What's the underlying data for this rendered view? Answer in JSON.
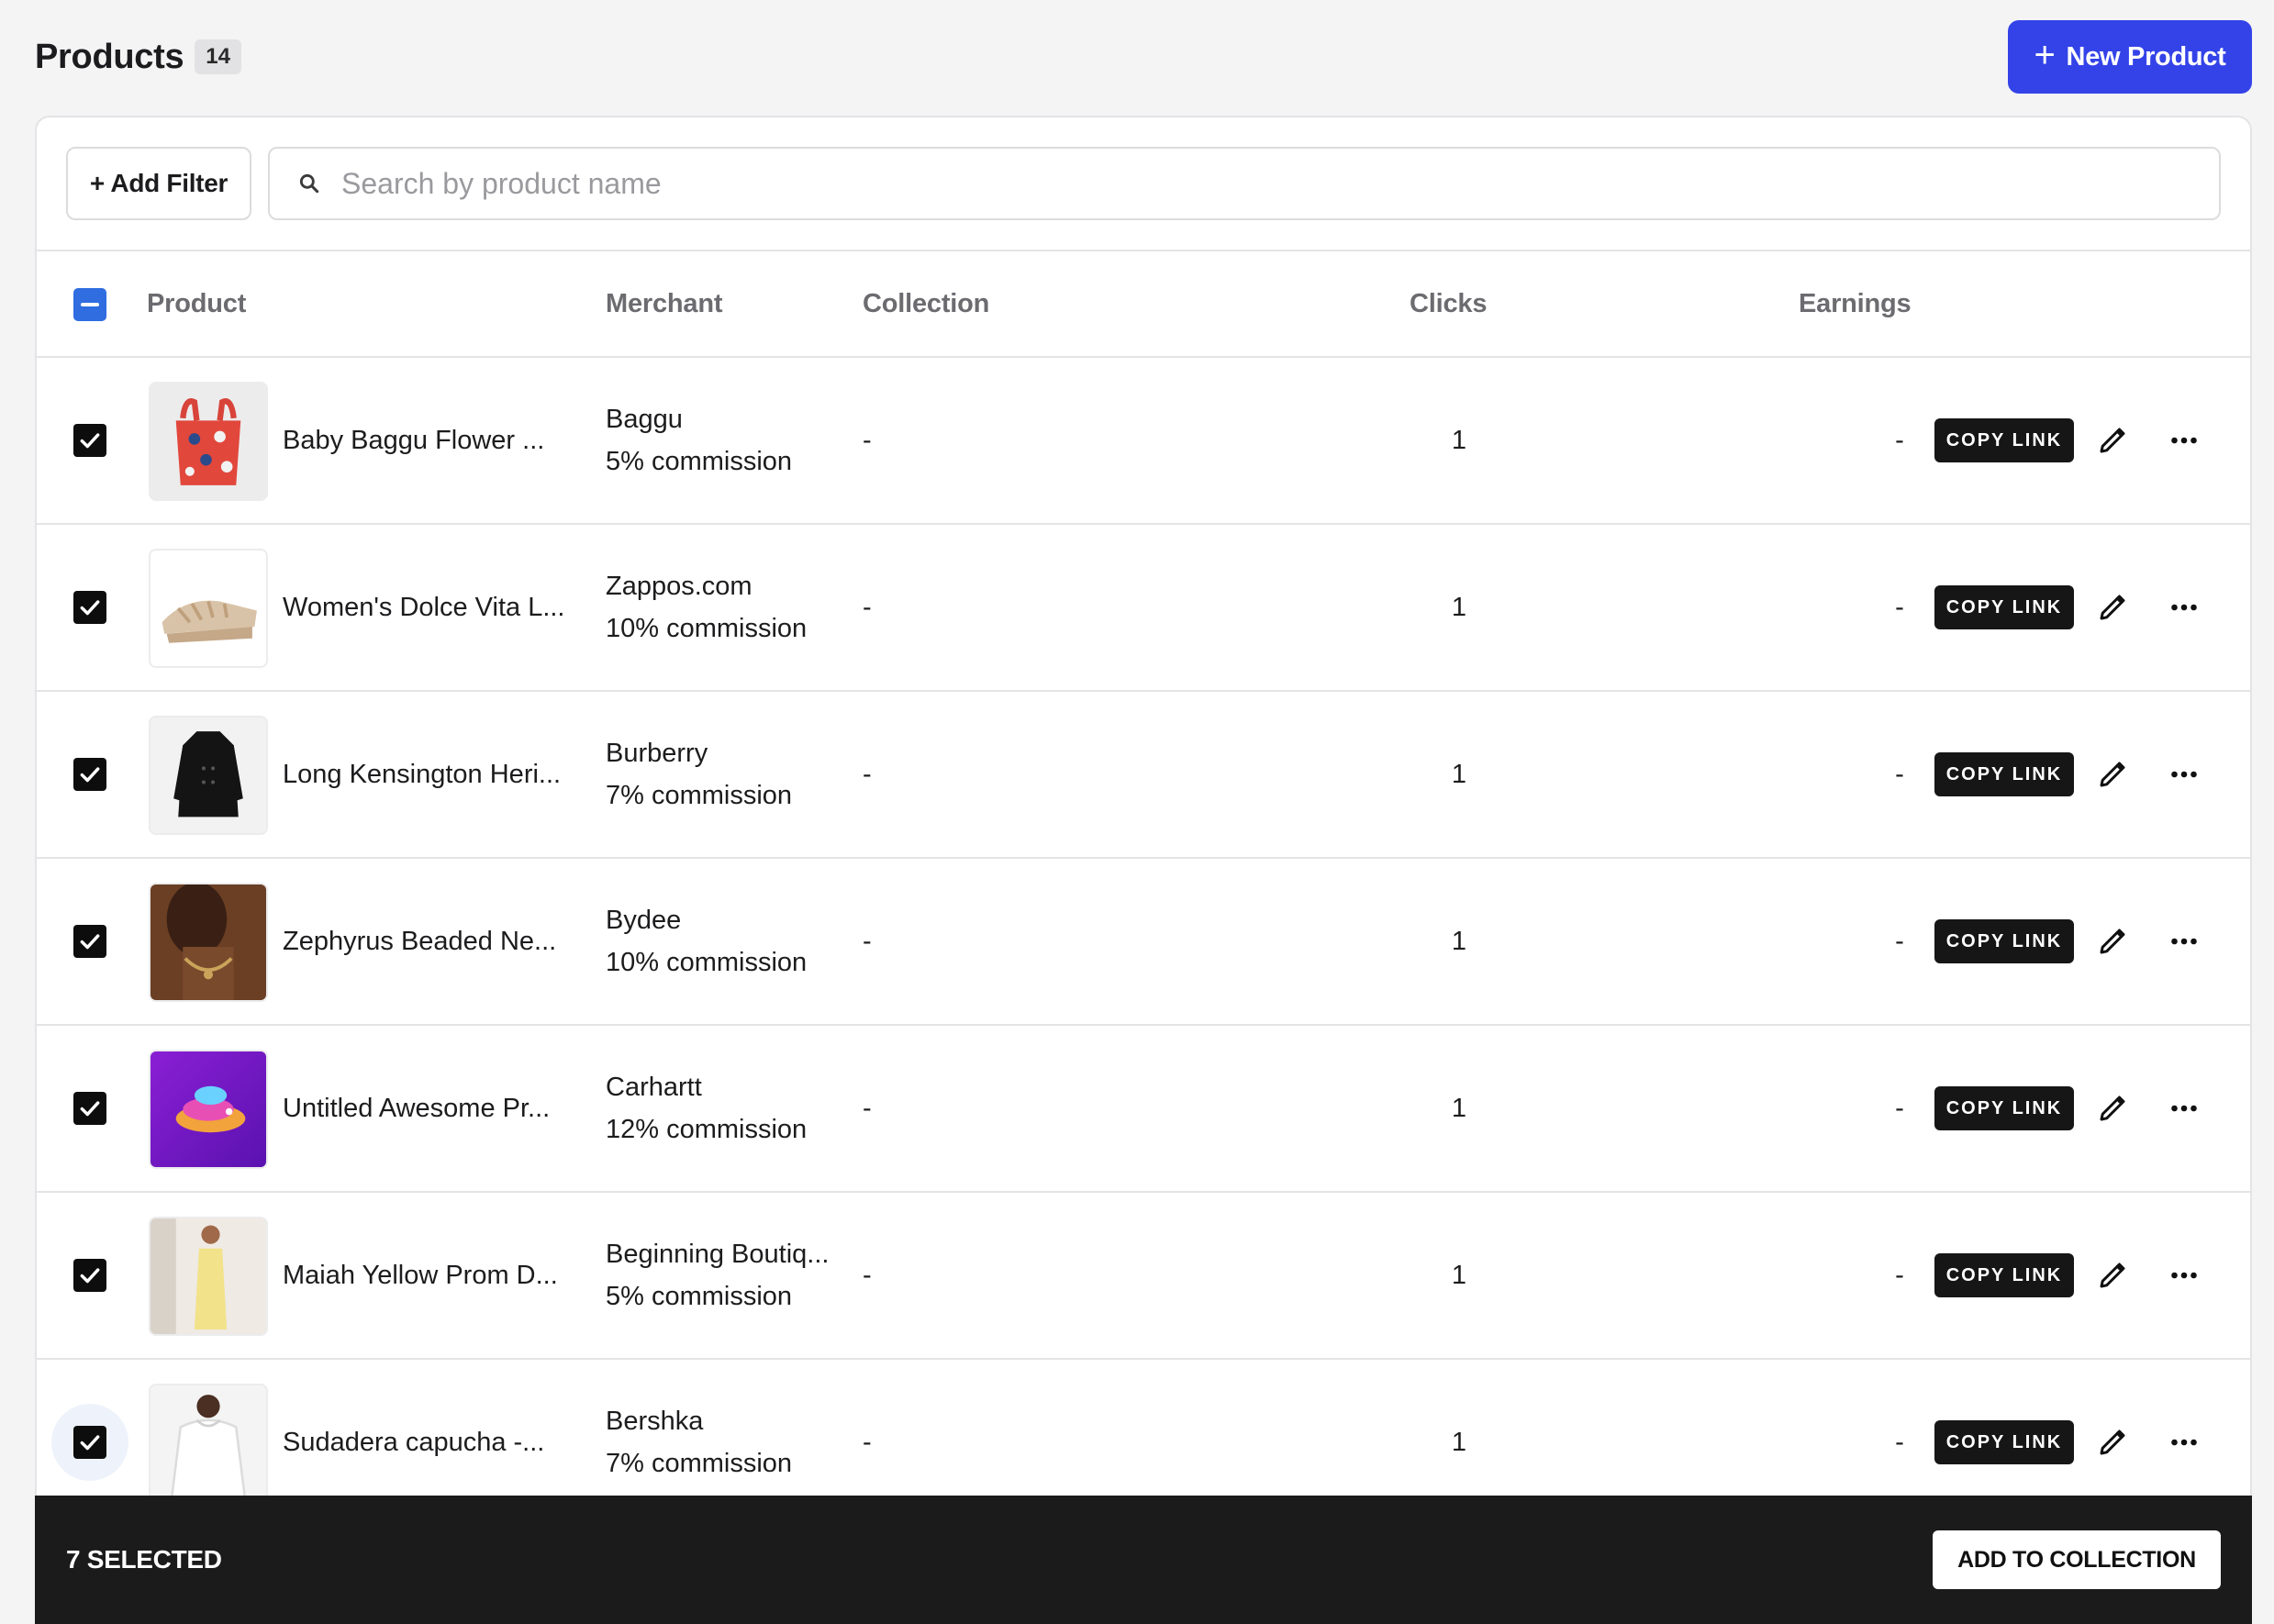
{
  "header": {
    "title": "Products",
    "count": "14",
    "new_product_label": "New Product"
  },
  "toolbar": {
    "add_filter_label": "+ Add Filter",
    "search_placeholder": "Search by product name",
    "search_value": ""
  },
  "table": {
    "columns": [
      "Product",
      "Merchant",
      "Collection",
      "Clicks",
      "Earnings"
    ],
    "header_checkbox_state": "indeterminate",
    "copy_link_label": "COPY LINK",
    "rows": [
      {
        "name": "Baby Baggu Flower ...",
        "merchant": "Baggu",
        "commission": "5% commission",
        "collection": "-",
        "clicks": "1",
        "earnings": "-",
        "checked": true,
        "thumb": "tote-bag"
      },
      {
        "name": "Women's Dolce Vita L...",
        "merchant": "Zappos.com",
        "commission": "10% commission",
        "collection": "-",
        "clicks": "1",
        "earnings": "-",
        "checked": true,
        "thumb": "sandals"
      },
      {
        "name": "Long Kensington Heri...",
        "merchant": "Burberry",
        "commission": "7% commission",
        "collection": "-",
        "clicks": "1",
        "earnings": "-",
        "checked": true,
        "thumb": "coat"
      },
      {
        "name": "Zephyrus Beaded Ne...",
        "merchant": "Bydee",
        "commission": "10% commission",
        "collection": "-",
        "clicks": "1",
        "earnings": "-",
        "checked": true,
        "thumb": "necklace"
      },
      {
        "name": "Untitled Awesome Pr...",
        "merchant": "Carhartt",
        "commission": "12% commission",
        "collection": "-",
        "clicks": "1",
        "earnings": "-",
        "checked": true,
        "thumb": "abstract"
      },
      {
        "name": "Maiah Yellow Prom D...",
        "merchant": "Beginning Boutiq...",
        "commission": "5% commission",
        "collection": "-",
        "clicks": "1",
        "earnings": "-",
        "checked": true,
        "thumb": "dress"
      },
      {
        "name": "Sudadera capucha -...",
        "merchant": "Bershka",
        "commission": "7% commission",
        "collection": "-",
        "clicks": "1",
        "earnings": "-",
        "checked": true,
        "thumb": "hoodie"
      }
    ]
  },
  "selection_bar": {
    "selected_label": "7 SELECTED",
    "add_to_collection_label": "ADD TO COLLECTION"
  },
  "colors": {
    "primary": "#3343e8",
    "checkbox_blue": "#2f6de0",
    "dark": "#1b1b1b"
  },
  "icons": [
    "plus-icon",
    "search-icon",
    "checkmark-icon",
    "minus-icon",
    "pencil-icon",
    "more-horizontal-icon"
  ]
}
